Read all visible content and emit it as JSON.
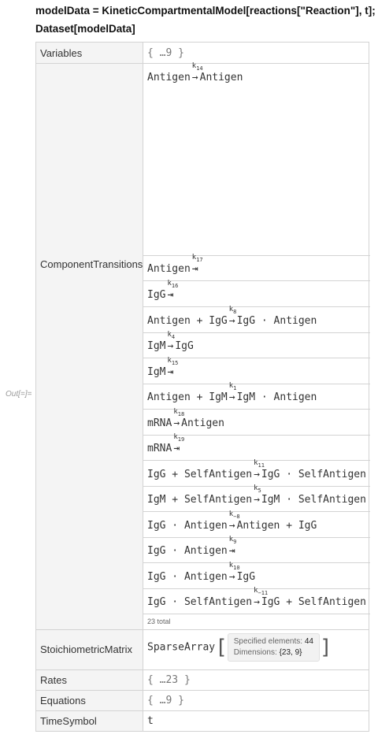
{
  "input": {
    "line1": "modelData = KineticCompartmentalModel[reactions[\"Reaction\"], t];",
    "line2": "Dataset[modelData]"
  },
  "out_label": "Out[=]=",
  "dataset": {
    "variables": {
      "key": "Variables",
      "value": "{ …9 }"
    },
    "component_transitions": {
      "key": "ComponentTransitions",
      "rows": [
        {
          "left": "Antigen",
          "rate": "k",
          "rate_sub": "14",
          "right": "Antigen"
        },
        {
          "left": "Antigen",
          "rate": "k",
          "rate_sub": "17",
          "right": ""
        },
        {
          "left": "IgG",
          "rate": "k",
          "rate_sub": "16",
          "right": ""
        },
        {
          "left": "Antigen + IgG",
          "rate": "k",
          "rate_sub": "8",
          "right": "IgG · Antigen"
        },
        {
          "left": "IgM",
          "rate": "k",
          "rate_sub": "4",
          "right": "IgG"
        },
        {
          "left": "IgM",
          "rate": "k",
          "rate_sub": "15",
          "right": ""
        },
        {
          "left": "Antigen + IgM",
          "rate": "k",
          "rate_sub": "1",
          "right": "IgM · Antigen"
        },
        {
          "left": "mRNA",
          "rate": "k",
          "rate_sub": "18",
          "right": "Antigen"
        },
        {
          "left": "mRNA",
          "rate": "k",
          "rate_sub": "19",
          "right": ""
        },
        {
          "left": "IgG + SelfAntigen",
          "rate": "k",
          "rate_sub": "11",
          "right": "IgG · SelfAntigen"
        },
        {
          "left": "IgM + SelfAntigen",
          "rate": "k",
          "rate_sub": "5",
          "right": "IgM · SelfAntigen"
        },
        {
          "left": "IgG · Antigen",
          "rate": "k",
          "rate_sub": "−8",
          "right": "Antigen + IgG"
        },
        {
          "left": "IgG · Antigen",
          "rate": "k",
          "rate_sub": "9",
          "right": ""
        },
        {
          "left": "IgG · Antigen",
          "rate": "k",
          "rate_sub": "10",
          "right": "IgG"
        },
        {
          "left": "IgG · SelfAntigen",
          "rate": "k",
          "rate_sub": "−11",
          "right": "IgG + SelfAntigen"
        }
      ],
      "total": "23 total"
    },
    "stoichiometric": {
      "key": "StoichiometricMatrix",
      "head": "SparseArray",
      "specified_label": "Specified elements:",
      "specified_value": "44",
      "dimensions_label": "Dimensions:",
      "dimensions_value": "{23, 9}"
    },
    "rates": {
      "key": "Rates",
      "value": "{ …23 }"
    },
    "equations": {
      "key": "Equations",
      "value": "{ …9 }"
    },
    "time_symbol": {
      "key": "TimeSymbol",
      "value": "t"
    }
  }
}
